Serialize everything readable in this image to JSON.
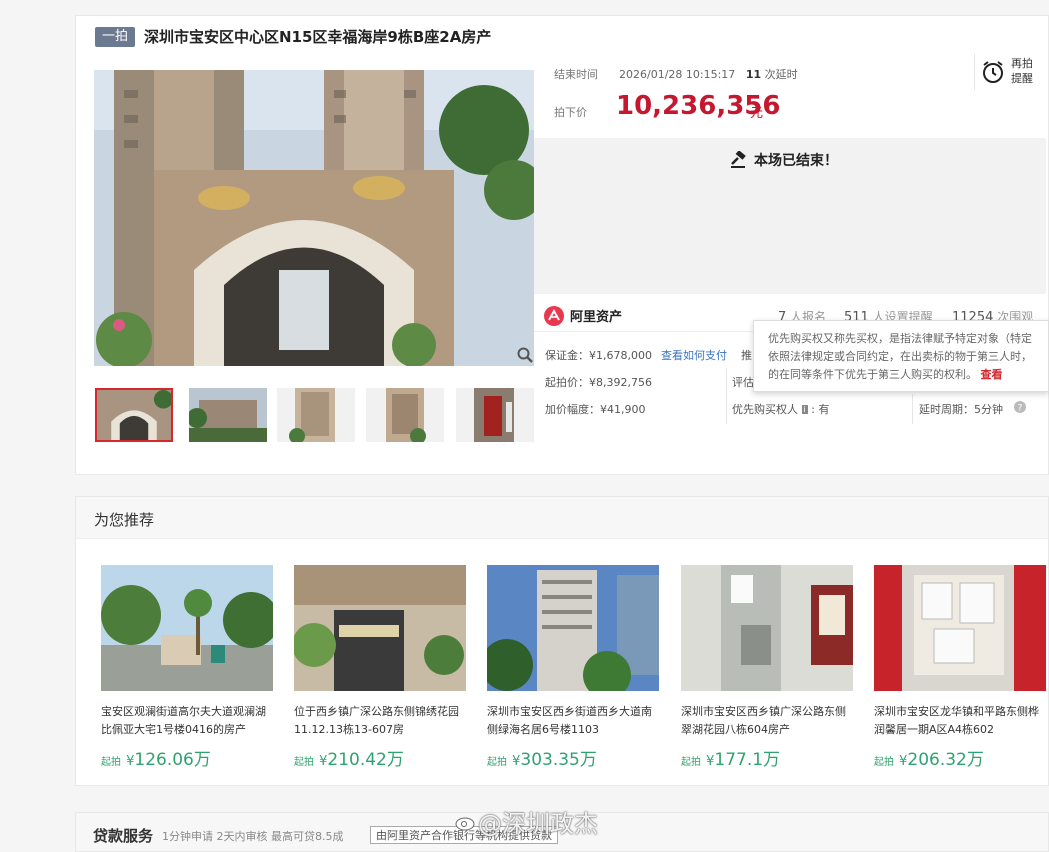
{
  "auction": {
    "badge": "一拍",
    "title": "深圳市宝安区中心区N15区幸福海岸9栋B座2A房产",
    "end_label": "结束时间",
    "end_time": "2026/01/28 10:15:17",
    "delay_count": "11",
    "delay_suffix": "次延时",
    "price_label": "拍下价",
    "price_value": "10,236,356",
    "price_unit": "元",
    "remind_label": "再拍提醒",
    "ended_text": "本场已结束！",
    "platform": "阿里资产",
    "stats": [
      {
        "num": "7",
        "label": "人报名"
      },
      {
        "num": "511",
        "label": "人设置提醒"
      },
      {
        "num": "11254",
        "label": "次围观"
      }
    ],
    "deposit": "保证金：¥1,678,000",
    "pay_link": "查看如何支付",
    "push_text": "推",
    "start_price": "起拍价：¥8,392,756",
    "assess": "评估",
    "increment": "加价幅度：¥41,900",
    "preempt_label": "优先购买权人",
    "preempt_value": "有",
    "extend": "延时周期：5分钟"
  },
  "tooltip": {
    "line1": "优先购买权又称先买权，是指法律赋予特定对象（特定",
    "line2": "依照法律规定或合同约定，在出卖标的物于第三人时，",
    "line3": "的在同等条件下优先于第三人购买的权利。",
    "link": "查看"
  },
  "recommend": {
    "title": "为您推荐",
    "price_prefix": "起拍",
    "currency": "¥",
    "items": [
      {
        "desc": "宝安区观澜街道高尔夫大道观澜湖比佩亚大宅1号楼0416的房产",
        "price": "126.06万"
      },
      {
        "desc": "位于西乡镇广深公路东侧锦绣花园11.12.13栋13-607房",
        "price": "210.42万"
      },
      {
        "desc": "深圳市宝安区西乡街道西乡大道南侧绿海名居6号楼1103",
        "price": "303.35万"
      },
      {
        "desc": "深圳市宝安区西乡镇广深公路东侧翠湖花园八栋604房产",
        "price": "177.1万"
      },
      {
        "desc": "深圳市宝安区龙华镇和平路东侧桦润馨居一期A区A4栋602",
        "price": "206.32万"
      }
    ]
  },
  "loan": {
    "title": "贷款服务",
    "subtitle": "1分钟申请 2天内审核 最高可贷8.5成",
    "tag": "由阿里资产合作银行等机构提供贷款"
  },
  "watermark": "@深圳政杰",
  "colors": {
    "price": "#c5182f",
    "accent_green": "#2fa36f",
    "link": "#3a74c2",
    "badge": "#6b7a90"
  }
}
